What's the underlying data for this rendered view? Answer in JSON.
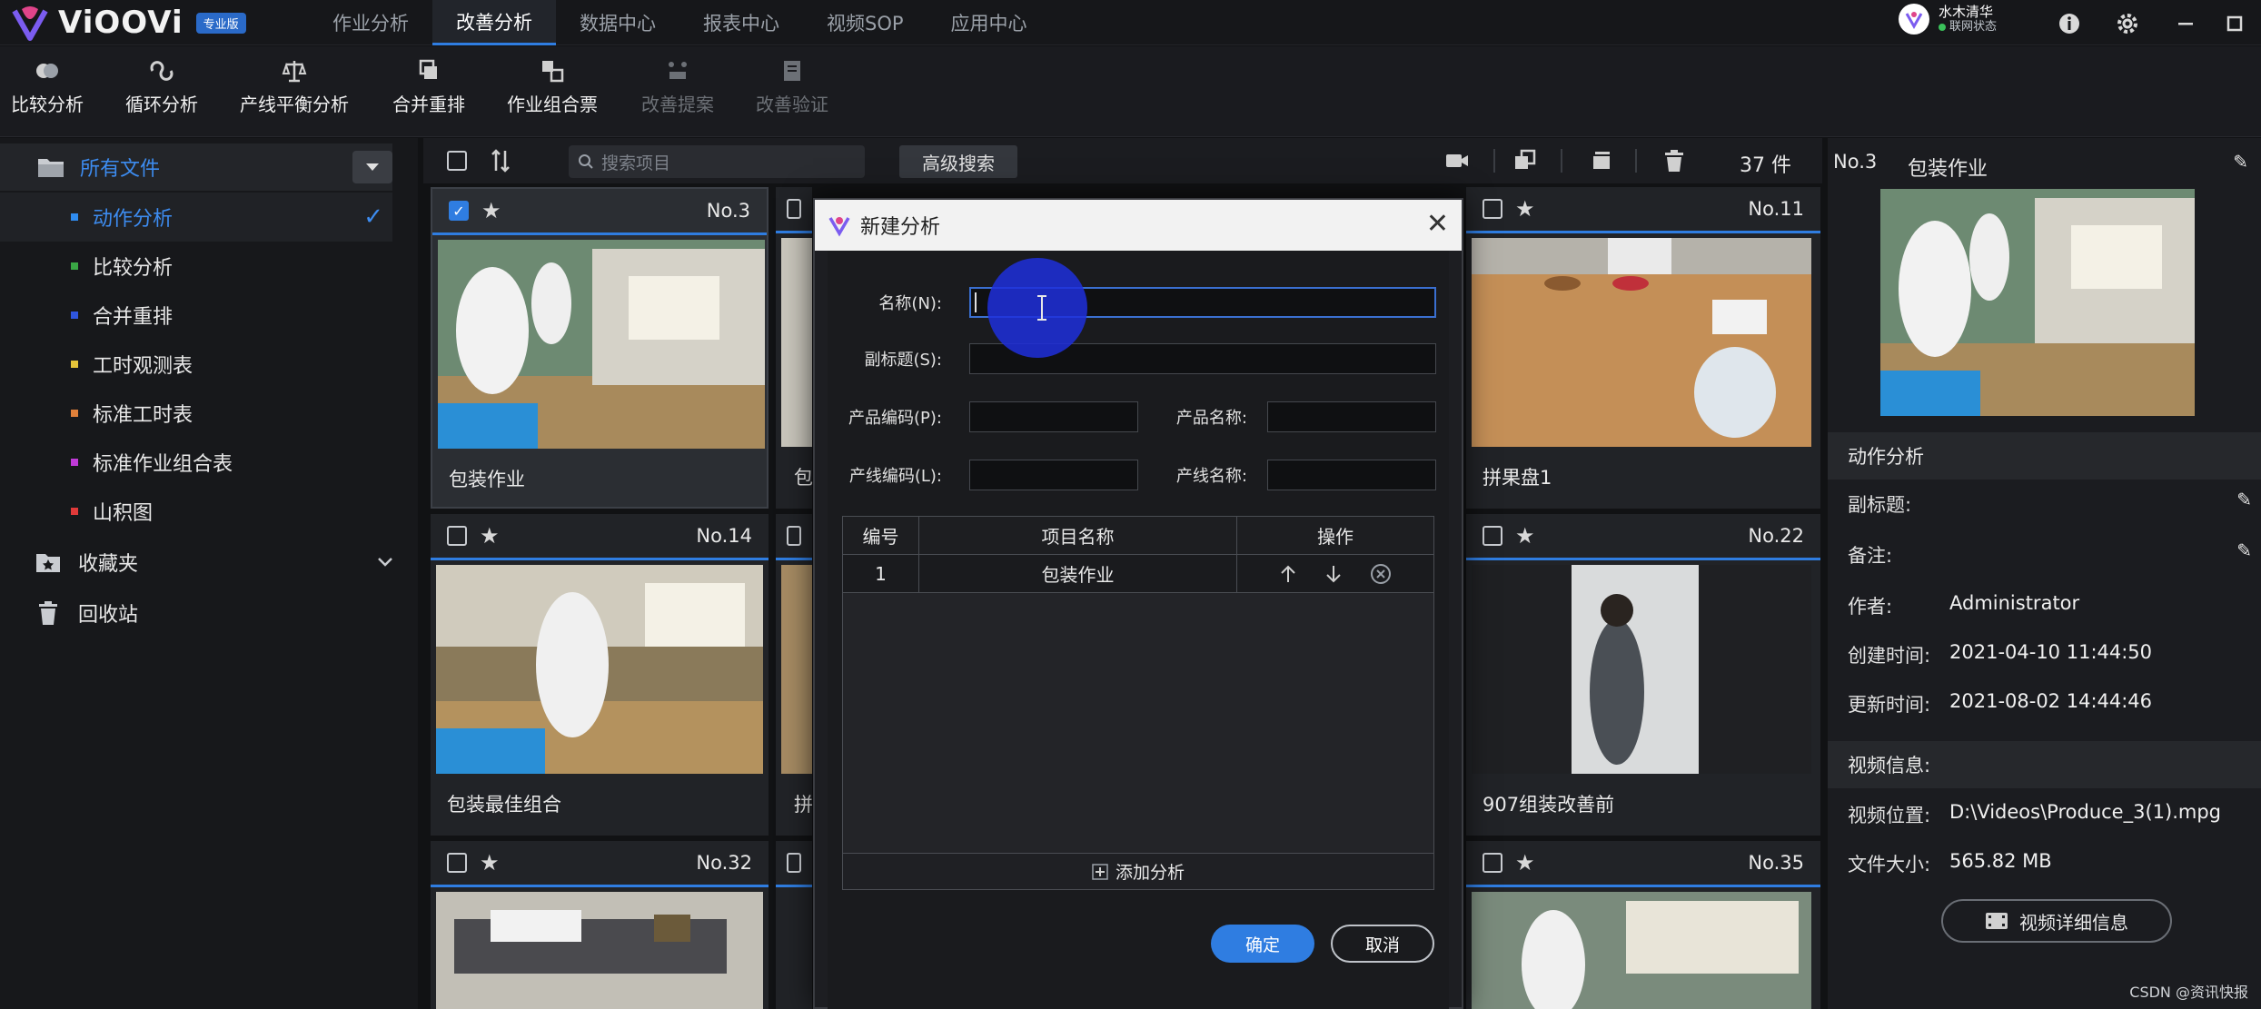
{
  "app": {
    "name": "ViOOVi",
    "edition": "专业版"
  },
  "nav": [
    "作业分析",
    "改善分析",
    "数据中心",
    "报表中心",
    "视频SOP",
    "应用中心"
  ],
  "nav_active": "改善分析",
  "user": {
    "name": "水木清华",
    "status": "联网状态"
  },
  "toolbar": {
    "items": [
      "比较分析",
      "循环分析",
      "产线平衡分析",
      "合并重排",
      "作业组合票",
      "改善提案",
      "改善验证"
    ]
  },
  "sidebar": {
    "root": "所有文件",
    "items": [
      {
        "label": "动作分析",
        "color": "#2f8cf0"
      },
      {
        "label": "比较分析",
        "color": "#3aa845"
      },
      {
        "label": "合并重排",
        "color": "#2f56e0"
      },
      {
        "label": "工时观测表",
        "color": "#e6c53a"
      },
      {
        "label": "标准工时表",
        "color": "#e0803a"
      },
      {
        "label": "标准作业组合表",
        "color": "#c03ad8"
      },
      {
        "label": "山积图",
        "color": "#e03a3a"
      }
    ],
    "favorites": "收藏夹",
    "trash": "回收站"
  },
  "grid": {
    "search_placeholder": "搜索项目",
    "advanced_search": "高级搜索",
    "count": "37 件",
    "cards": [
      {
        "no": "No.3",
        "title": "包装作业"
      },
      {
        "no": "No.11",
        "title": "拼果盘1"
      },
      {
        "no": "No.14",
        "title": "包装最佳组合"
      },
      {
        "no": "No.22",
        "title": "907组装改善前"
      },
      {
        "no": "No.32",
        "title": ""
      },
      {
        "no": "No.35",
        "title": ""
      }
    ],
    "partial_titles": [
      "包",
      "拼"
    ]
  },
  "detail": {
    "no": "No.3",
    "title": "包装作业",
    "section_analysis": "动作分析",
    "subtitle_label": "副标题:",
    "note_label": "备注:",
    "author_label": "作者:",
    "author": "Administrator",
    "created_label": "创建时间:",
    "created": "2021-04-10 11:44:50",
    "updated_label": "更新时间:",
    "updated": "2021-08-02 14:44:46",
    "section_video": "视频信息:",
    "video_path_label": "视频位置:",
    "video_path": "D:\\Videos\\Produce_3(1).mpg",
    "file_size_label": "文件大小:",
    "file_size": "565.82 MB",
    "video_details_btn": "视频详细信息"
  },
  "dialog": {
    "title": "新建分析",
    "name_label": "名称(N):",
    "name_value": "",
    "subtitle_label": "副标题(S):",
    "product_code_label": "产品编码(P):",
    "product_name_label": "产品名称:",
    "line_code_label": "产线编码(L):",
    "line_name_label": "产线名称:",
    "table": {
      "headers": [
        "编号",
        "项目名称",
        "操作"
      ],
      "rows": [
        {
          "id": "1",
          "name": "包装作业"
        }
      ]
    },
    "add_analysis": "添加分析",
    "ok": "确定",
    "cancel": "取消"
  },
  "watermark": "CSDN @资讯快报"
}
